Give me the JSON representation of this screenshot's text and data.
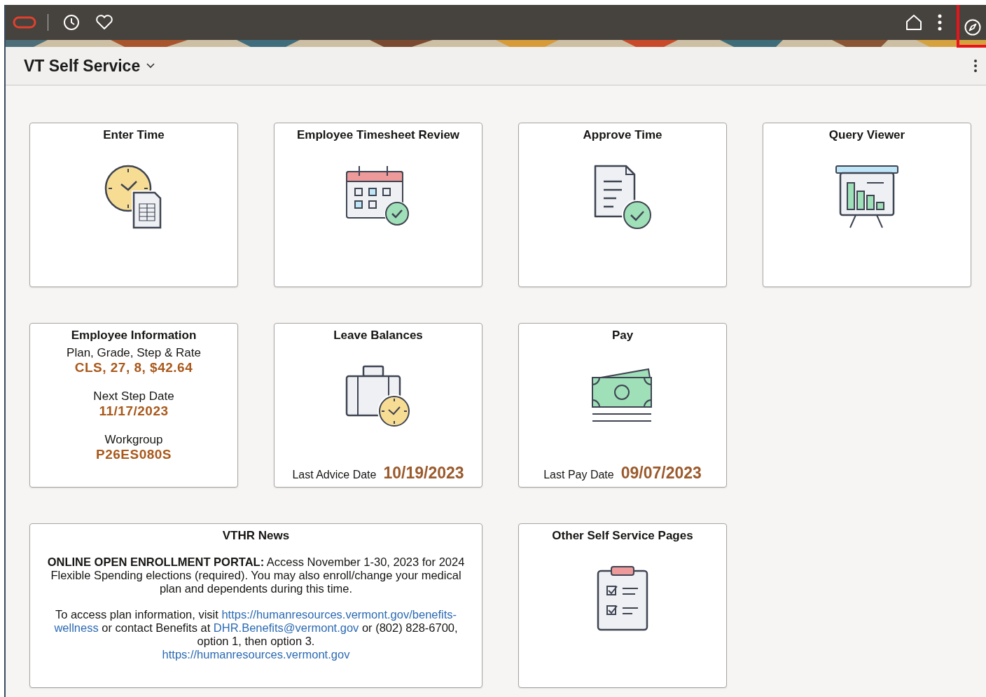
{
  "header": {
    "title": "VT Self Service"
  },
  "tiles": [
    {
      "kind": "icon",
      "title": "Enter Time"
    },
    {
      "kind": "icon",
      "title": "Employee Timesheet Review"
    },
    {
      "kind": "icon",
      "title": "Approve Time"
    },
    {
      "kind": "icon",
      "title": "Query Viewer"
    },
    {
      "kind": "info",
      "title": "Employee Information",
      "fields": [
        {
          "label": "Plan, Grade, Step & Rate",
          "value": "CLS, 27, 8, $42.64"
        },
        {
          "label": "Next Step Date",
          "value": "11/17/2023"
        },
        {
          "label": "Workgroup",
          "value": "P26ES080S"
        }
      ]
    },
    {
      "kind": "date",
      "title": "Leave Balances",
      "label": "Last Advice Date",
      "value": "10/19/2023"
    },
    {
      "kind": "date",
      "title": "Pay",
      "label": "Last Pay Date",
      "value": "09/07/2023"
    },
    {
      "kind": "news",
      "title": "VTHR News",
      "paragraphs": [
        [
          {
            "kind": "text",
            "text": "**ONLINE OPEN ENROLLMENT PORTAL:** Access November 1-30, 2023 for 2024 Flexible Spending elections (required). You may also enroll/change your medical plan and dependents during this time."
          }
        ],
        [
          {
            "kind": "text",
            "text": "To access plan information, visit "
          },
          {
            "kind": "link",
            "text": "https://humanresources.vermont.gov/benefits-"
          },
          {
            "kind": "break"
          },
          {
            "kind": "link",
            "text": "wellness"
          },
          {
            "kind": "text",
            "text": " or contact Benefits at "
          },
          {
            "kind": "link",
            "text": "DHR.Benefits@vermont.gov"
          },
          {
            "kind": "text",
            "text": " or (802) 828-6700, option 1, then option 3."
          },
          {
            "kind": "break"
          },
          {
            "kind": "link",
            "text": "https://humanresources.vermont.gov"
          }
        ]
      ]
    },
    {
      "kind": "icon",
      "title": "Other Self Service Pages"
    }
  ]
}
